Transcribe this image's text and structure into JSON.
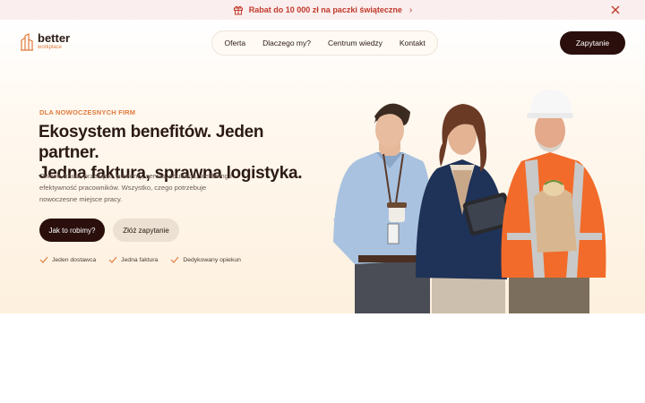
{
  "promo": {
    "text": "Rabat do 10 000 zł na paczki świąteczne",
    "icon": "gift-icon",
    "accent": "#c0392b",
    "background": "#fbeeee"
  },
  "brand": {
    "name": "better",
    "tagline": "workplace"
  },
  "nav": {
    "items": [
      {
        "label": "Oferta"
      },
      {
        "label": "Dlaczego my?"
      },
      {
        "label": "Centrum wiedzy"
      },
      {
        "label": "Kontakt"
      }
    ]
  },
  "header": {
    "cta_label": "Zapytanie"
  },
  "hero": {
    "eyebrow": "DLA NOWOCZESNYCH FIRM",
    "headline_line1": "Ekosystem benefitów. Jeden partner.",
    "headline_line2": "Jedna faktura, sprawna logistyka.",
    "description": "Owoce, kawa, przekąski, prezenty, serwis, edukacja, wellbeing i efektywność pracowników. Wszystko, czego potrzebuje nowoczesne miejsce pracy.",
    "primary_button": "Jak to robimy?",
    "secondary_button": "Złóż zapytanie",
    "features": [
      {
        "label": "Jeden dostawca",
        "icon": "check-icon"
      },
      {
        "label": "Jedna faktura",
        "icon": "check-icon"
      },
      {
        "label": "Dedykowany opiekun",
        "icon": "check-icon"
      }
    ]
  },
  "colors": {
    "primary_dark": "#2a0f0c",
    "accent_orange": "#e07a3c",
    "secondary_button": "#ece0d2"
  }
}
